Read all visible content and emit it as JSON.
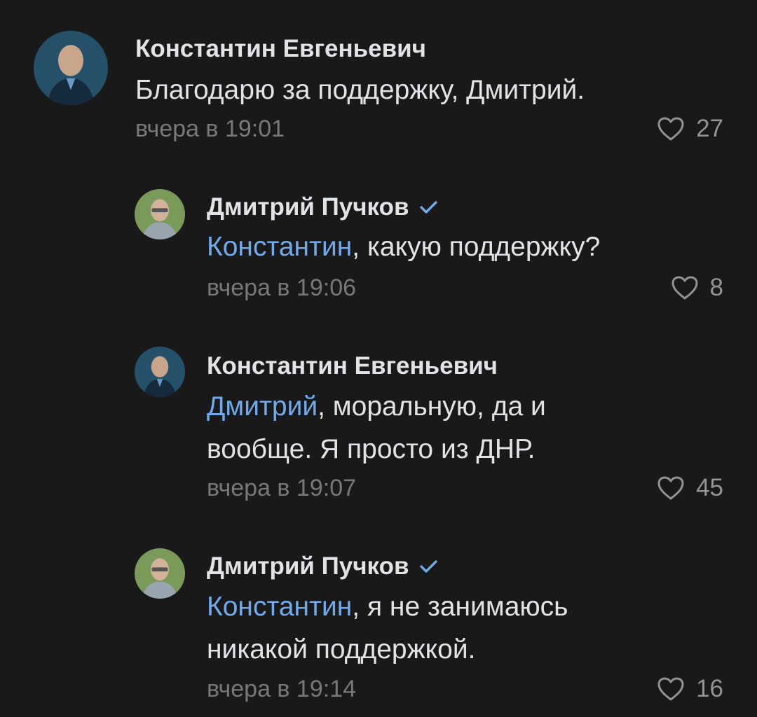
{
  "comments": [
    {
      "author": "Константин Евгеньевич",
      "verified": false,
      "mention": "",
      "text": "Благодарю за поддержку, Дмитрий.",
      "text_line2": "",
      "time": "вчера в 19:01",
      "likes": "27"
    },
    {
      "author": "Дмитрий Пучков",
      "verified": true,
      "mention": "Константин",
      "text": ", какую поддержку?",
      "text_line2": "",
      "time": "вчера в 19:06",
      "likes": "8"
    },
    {
      "author": "Константин Евгеньевич",
      "verified": false,
      "mention": "Дмитрий",
      "text": ", моральную, да и",
      "text_line2": "вообще. Я просто из ДНР.",
      "time": "вчера в 19:07",
      "likes": "45"
    },
    {
      "author": "Дмитрий Пучков",
      "verified": true,
      "mention": "Константин",
      "text": ", я не занимаюсь",
      "text_line2": "никакой поддержкой.",
      "time": "вчера в 19:14",
      "likes": "16"
    }
  ],
  "colors": {
    "background": "#19191a",
    "text": "#e1e3e6",
    "mention": "#71aaeb",
    "meta": "#76787a",
    "verified": "#71aaeb"
  },
  "icons": {
    "like": "heart-outline-icon",
    "verified": "checkmark-icon"
  }
}
